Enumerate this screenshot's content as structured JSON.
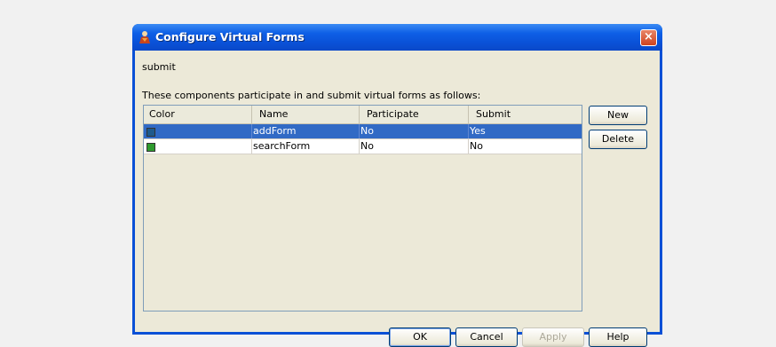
{
  "dialog": {
    "title": "Configure Virtual Forms",
    "close_label": "×"
  },
  "form_name": "submit",
  "instructions": "These components participate in and submit virtual forms as follows:",
  "table": {
    "columns": [
      "Color",
      "Name",
      "Participate",
      "Submit"
    ],
    "rows": [
      {
        "color": "#1f5a8c",
        "name": "addForm",
        "participate": "No",
        "submit": "Yes",
        "selected": true
      },
      {
        "color": "#2e9a2e",
        "name": "searchForm",
        "participate": "No",
        "submit": "No",
        "selected": false
      }
    ]
  },
  "side_buttons": {
    "new": "New",
    "delete": "Delete"
  },
  "bottom_buttons": {
    "ok": "OK",
    "cancel": "Cancel",
    "apply": "Apply",
    "help": "Help"
  }
}
